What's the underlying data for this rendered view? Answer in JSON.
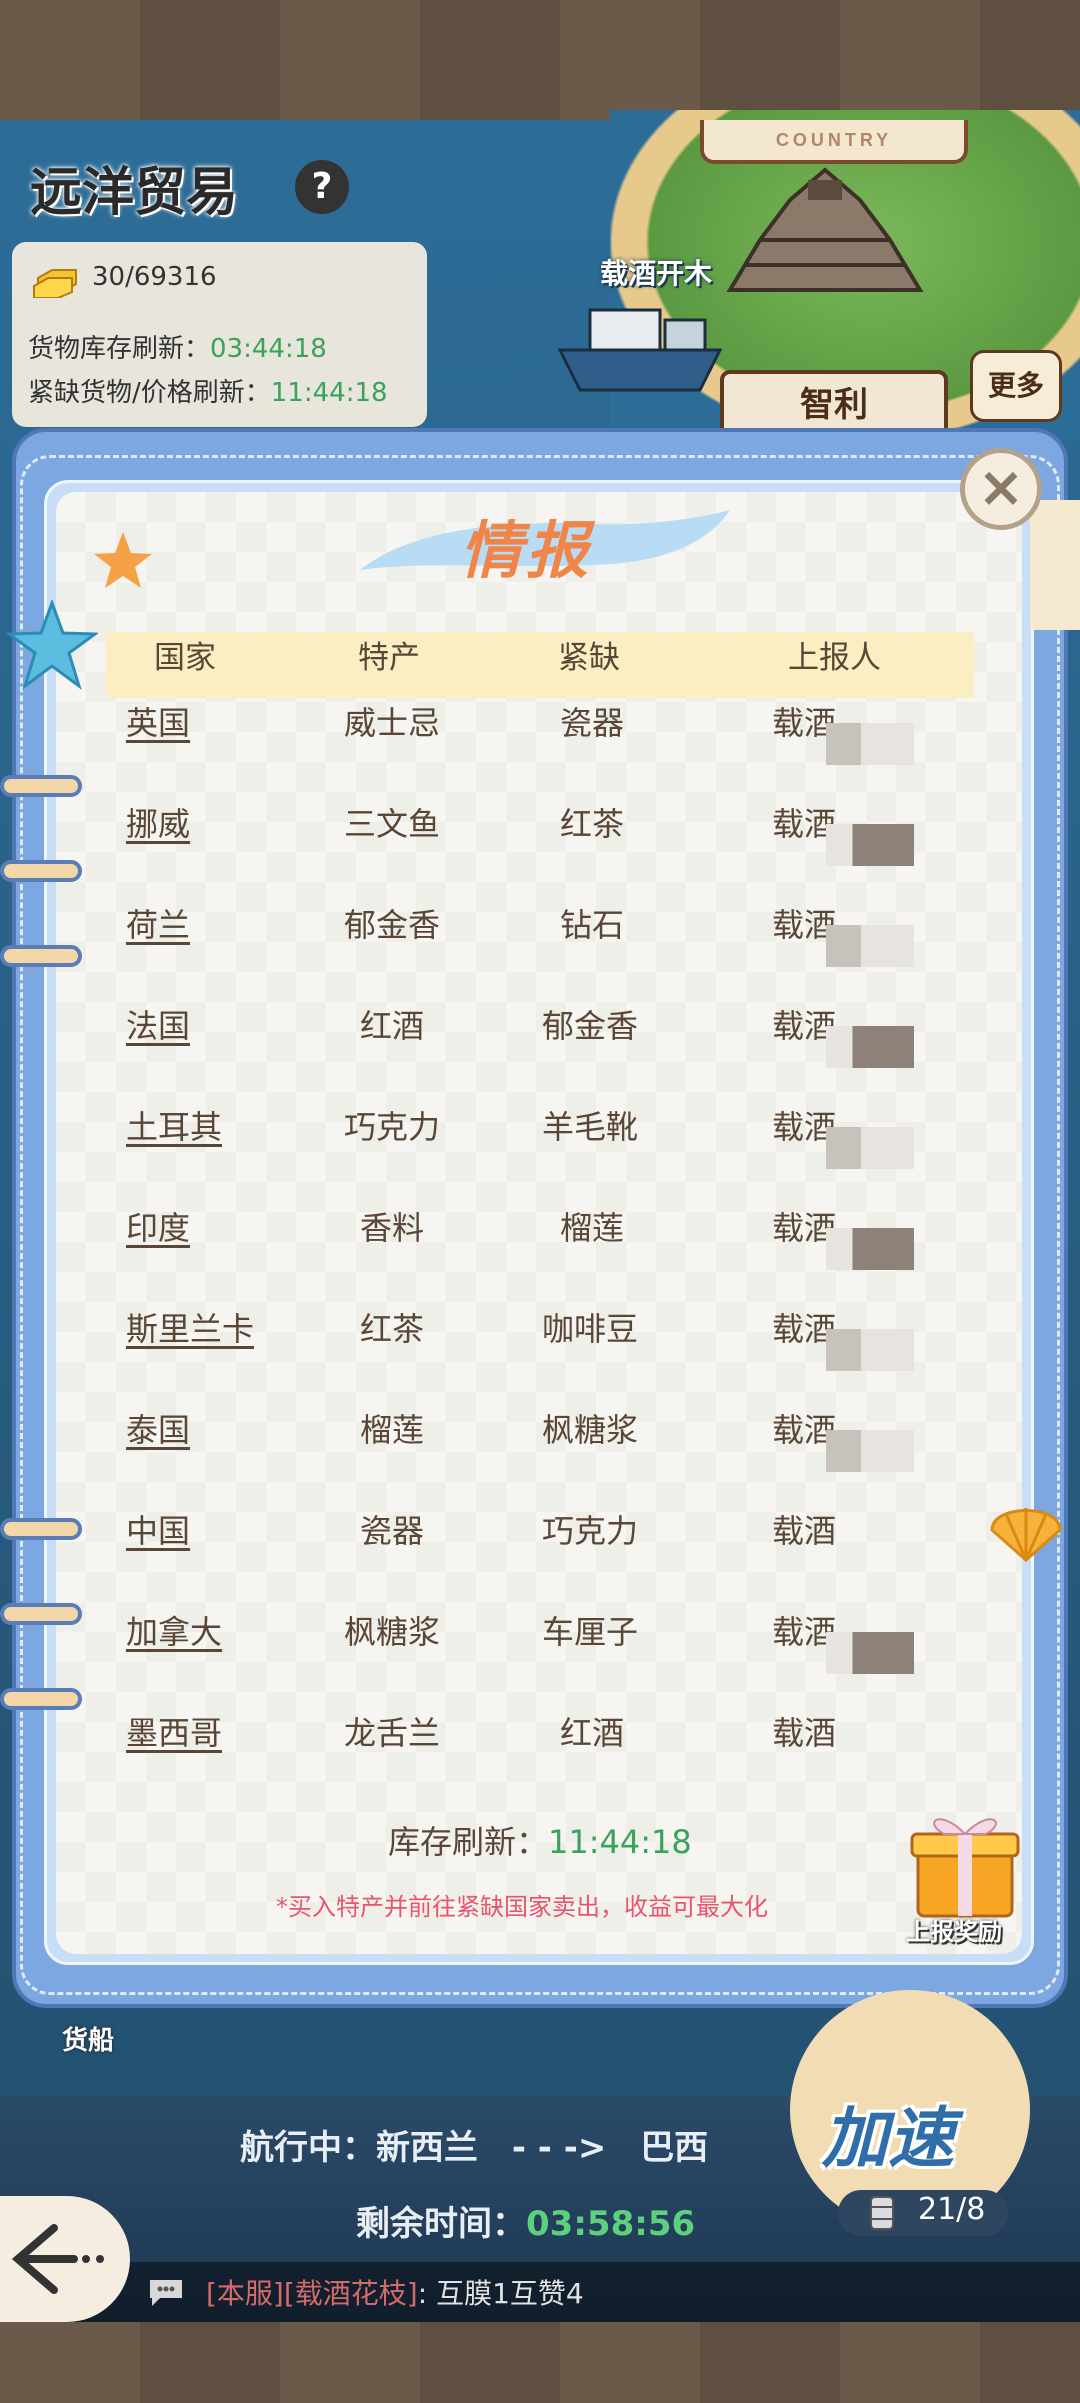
{
  "map": {
    "country_sign": "COUNTRY",
    "port_label": "载酒开木",
    "chile_label": "智利",
    "more_button": "更多",
    "trade_title": "远洋贸易",
    "help_icon": "?",
    "gold": "30/69316",
    "stock_refresh_label": "货物库存刷新：",
    "stock_refresh_time": "03:44:18",
    "shortage_refresh_label": "紧缺货物/价格刷新：",
    "shortage_refresh_time": "11:44:18",
    "cargo_label": "货船"
  },
  "dialog": {
    "title": "情报",
    "close_icon": "×",
    "headers": [
      "国家",
      "特产",
      "紧缺",
      "上报人"
    ],
    "rows": [
      {
        "country": "英国",
        "specialty": "威士忌",
        "shortage": "瓷器",
        "reporter": "载酒"
      },
      {
        "country": "挪威",
        "specialty": "三文鱼",
        "shortage": "红茶",
        "reporter": "载酒"
      },
      {
        "country": "荷兰",
        "specialty": "郁金香",
        "shortage": "钻石",
        "reporter": "载酒"
      },
      {
        "country": "法国",
        "specialty": "红酒",
        "shortage": "郁金香",
        "reporter": "载酒"
      },
      {
        "country": "土耳其",
        "specialty": "巧克力",
        "shortage": "羊毛靴",
        "reporter": "载酒"
      },
      {
        "country": "印度",
        "specialty": "香料",
        "shortage": "榴莲",
        "reporter": "载酒"
      },
      {
        "country": "斯里兰卡",
        "specialty": "红茶",
        "shortage": "咖啡豆",
        "reporter": "载酒"
      },
      {
        "country": "泰国",
        "specialty": "榴莲",
        "shortage": "枫糖浆",
        "reporter": "载酒"
      },
      {
        "country": "中国",
        "specialty": "瓷器",
        "shortage": "巧克力",
        "reporter": "载酒"
      },
      {
        "country": "加拿大",
        "specialty": "枫糖浆",
        "shortage": "车厘子",
        "reporter": "载酒"
      },
      {
        "country": "墨西哥",
        "specialty": "龙舌兰",
        "shortage": "红酒",
        "reporter": "载酒"
      }
    ],
    "refresh_label": "库存刷新：",
    "refresh_time": "11:44:18",
    "hint": "*买入特产并前往紧缺国家卖出，收益可最大化",
    "reward_label": "上报奖励"
  },
  "voyage": {
    "sailing_label": "航行中：",
    "from": "新西兰",
    "arrow": "- - ->",
    "to": "巴西",
    "remaining_label": "剩余时间：",
    "remaining_time": "03:58:56",
    "speed_button": "加速",
    "fuel": "21/8"
  },
  "chat": {
    "tag1": "[本服]",
    "tag2": "[载酒花枝]",
    "sep": ":",
    "message": "互膜1互赞4"
  },
  "colors": {
    "accent_green": "#3aa35a",
    "hint_red": "#e9546b",
    "title_orange": "#f0854a",
    "dialog_blue": "#7ca7e0"
  }
}
